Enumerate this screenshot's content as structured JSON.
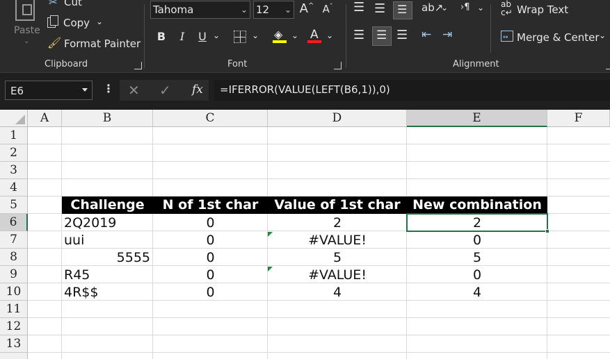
{
  "ribbon": {
    "clipboard": {
      "paste_label": "Paste",
      "cut_label": "Cut",
      "copy_label": "Copy",
      "format_painter_label": "Format Painter",
      "group_label": "Clipboard"
    },
    "font": {
      "font_name": "Tahoma",
      "font_size": "12",
      "bold": "B",
      "italic": "I",
      "underline": "U",
      "group_label": "Font"
    },
    "alignment": {
      "wrap_text_label": "Wrap Text",
      "merge_center_label": "Merge & Center",
      "group_label": "Alignment"
    }
  },
  "formula_bar": {
    "name_box": "E6",
    "fx": "fx",
    "formula": "=IFERROR(VALUE(LEFT(B6,1)),0)"
  },
  "grid": {
    "columns": [
      "A",
      "B",
      "C",
      "D",
      "E",
      "F"
    ],
    "selected_column": "E",
    "rows": [
      "1",
      "2",
      "3",
      "4",
      "5",
      "6",
      "7",
      "8",
      "9",
      "10",
      "11",
      "12",
      "13"
    ],
    "selected_row": "6",
    "header_row": [
      "Challenge",
      "N of 1st char",
      "Value of 1st char",
      "New combination"
    ],
    "data": [
      {
        "b": "2Q2019",
        "c": "0",
        "d": "2",
        "e": "2"
      },
      {
        "b": "uui",
        "c": "0",
        "d": "#VALUE!",
        "e": "0"
      },
      {
        "b": "5555",
        "c": "0",
        "d": "5",
        "e": "5"
      },
      {
        "b": "R45",
        "c": "0",
        "d": "#VALUE!",
        "e": "0"
      },
      {
        "b": "4R$$",
        "c": "0",
        "d": "4",
        "e": "4"
      }
    ]
  }
}
